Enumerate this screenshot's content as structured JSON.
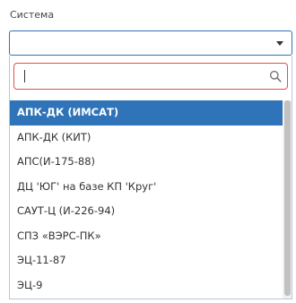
{
  "field": {
    "label": "Система",
    "value": ""
  },
  "search": {
    "value": "",
    "placeholder": ""
  },
  "options": [
    "АПК-ДК (ИМСАТ)",
    "АПК-ДК (КИТ)",
    "АПС(И-175-88)",
    "ДЦ 'ЮГ' на базе КП 'Круг'",
    "САУТ-Ц (И-226-94)",
    "СПЗ «ВЭРС-ПК»",
    "ЭЦ-11-87",
    "ЭЦ-9"
  ],
  "selected_index": 0,
  "colors": {
    "accent": "#2f73b8",
    "search_border": "#d9534f"
  },
  "icons": {
    "dropdown": "chevron-down-icon",
    "search": "search-icon"
  }
}
